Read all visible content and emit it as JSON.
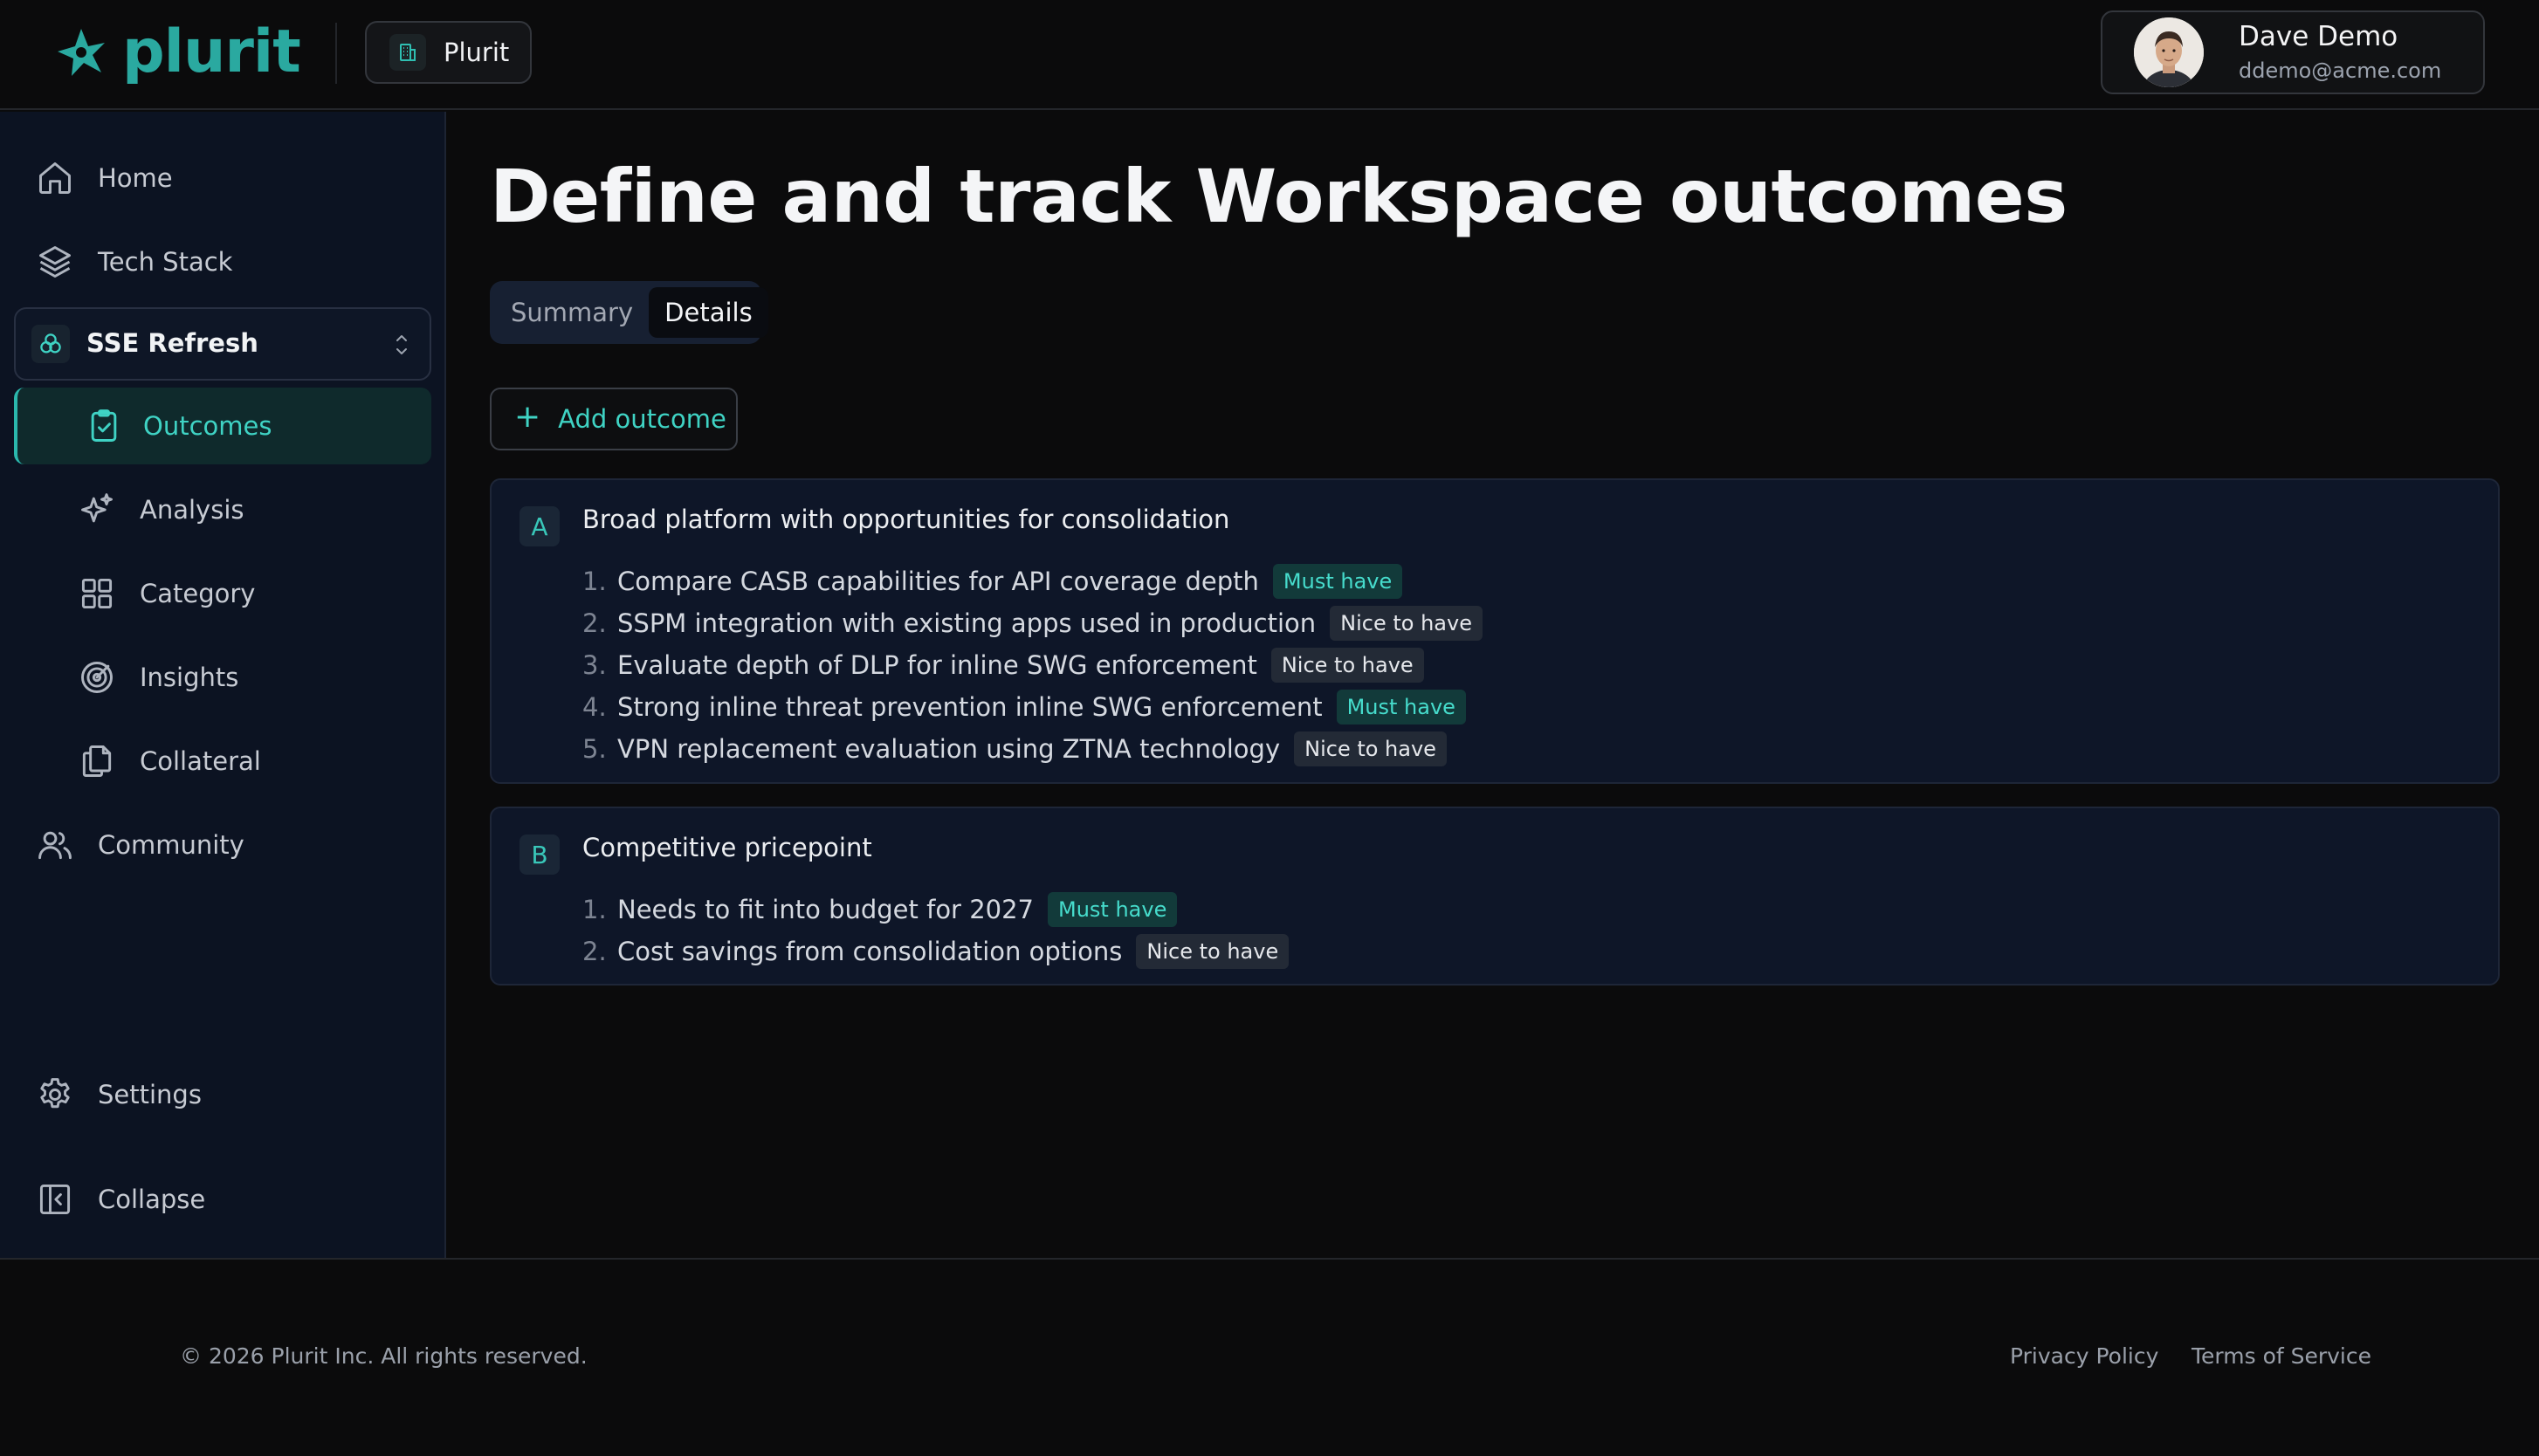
{
  "brand": {
    "name": "plurit",
    "accent": "#2aa9a0"
  },
  "header": {
    "workspace_label": "Plurit"
  },
  "user": {
    "name": "Dave Demo",
    "email": "ddemo@acme.com"
  },
  "sidebar": {
    "items": [
      {
        "label": "Home",
        "icon": "home-icon"
      },
      {
        "label": "Tech Stack",
        "icon": "layers-icon"
      }
    ],
    "project": {
      "label": "SSE Refresh",
      "icon": "triquetra-icon"
    },
    "sub_items": [
      {
        "label": "Outcomes",
        "icon": "clipboard-check-icon",
        "active": true
      },
      {
        "label": "Analysis",
        "icon": "sparkles-icon"
      },
      {
        "label": "Category",
        "icon": "grid-icon"
      },
      {
        "label": "Insights",
        "icon": "radar-icon"
      },
      {
        "label": "Collateral",
        "icon": "files-icon"
      }
    ],
    "community": {
      "label": "Community",
      "icon": "users-icon"
    },
    "settings": {
      "label": "Settings",
      "icon": "gear-icon"
    },
    "collapse": {
      "label": "Collapse",
      "icon": "collapse-panel-icon"
    }
  },
  "main": {
    "title": "Define and track Workspace outcomes",
    "tabs": [
      {
        "label": "Summary",
        "active": false
      },
      {
        "label": "Details",
        "active": true
      }
    ],
    "add_button_label": "Add outcome",
    "outcomes": [
      {
        "letter": "A",
        "title": "Broad platform with opportunities for consolidation",
        "items": [
          {
            "num": "1.",
            "text": "Compare CASB capabilities for API coverage depth",
            "priority": "Must have"
          },
          {
            "num": "2.",
            "text": "SSPM integration with existing apps used in production",
            "priority": "Nice to have"
          },
          {
            "num": "3.",
            "text": "Evaluate depth of DLP for inline SWG enforcement",
            "priority": "Nice to have"
          },
          {
            "num": "4.",
            "text": "Strong inline threat prevention inline SWG enforcement",
            "priority": "Must have"
          },
          {
            "num": "5.",
            "text": "VPN replacement evaluation using ZTNA technology",
            "priority": "Nice to have"
          }
        ]
      },
      {
        "letter": "B",
        "title": "Competitive pricepoint",
        "items": [
          {
            "num": "1.",
            "text": "Needs to fit into budget for 2027",
            "priority": "Must have"
          },
          {
            "num": "2.",
            "text": "Cost savings from consolidation options",
            "priority": "Nice to have"
          }
        ]
      }
    ]
  },
  "footer": {
    "copyright": "© 2026 Plurit Inc. All rights reserved.",
    "privacy": "Privacy Policy",
    "terms": "Terms of Service"
  }
}
